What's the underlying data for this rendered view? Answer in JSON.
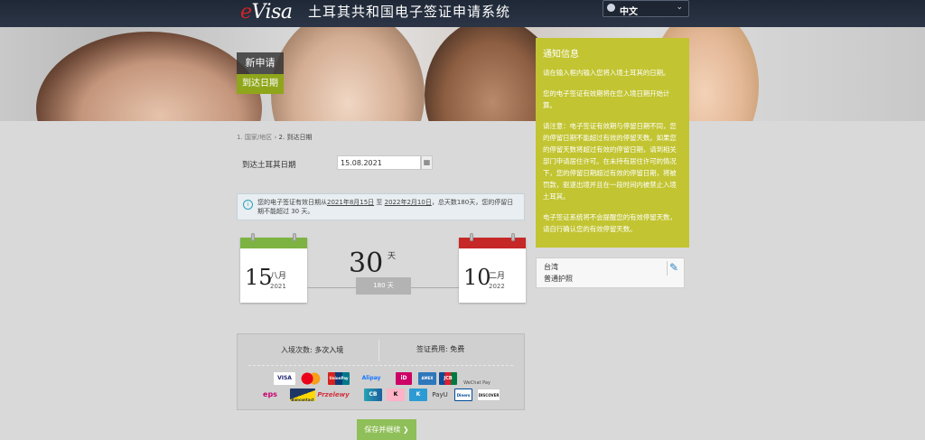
{
  "header": {
    "logo_e": "e",
    "logo_rest": "Visa",
    "title": "土耳其共和国电子签证申请系统",
    "language": "中文"
  },
  "hero": {
    "new_application": "新申请",
    "step_label": "到达日期"
  },
  "notice": {
    "title": "通知信息",
    "paragraphs": [
      "请在输入框内输入您将入境土耳其的日期。",
      "您的电子签证有效期将在您入境日期开始计算。",
      "请注意：电子签证有效期与停留日期不同，您的停留日期不能超过有效的停留天数。如果您的停留天数将超过有效的停留日期，请到相关部门申请居住许可。在未持有居住许可的情况下，您的停留日期超过有效的停留日期，将被罚款，驱逐出境并且在一段时间内被禁止入境土耳其。",
      "电子签证系统将不会提醒您的有效停留天数，请自行确认您的有效停留天数。"
    ]
  },
  "applicant": {
    "country": "台湾",
    "passport": "普通护照"
  },
  "breadcrumb": {
    "step1": "1. 国家/地区",
    "sep": "›",
    "step2": "2. 到达日期"
  },
  "form": {
    "arrival_label": "到达土耳其日期",
    "arrival_value": "15.08.2021"
  },
  "validity": {
    "prefix": "您的电子签证有效日期从",
    "start": "2021年8月15日",
    "mid": " 至 ",
    "end": "2022年2月10日",
    "suffix": "，总天数180天，您的停留日期不能超过 30 天。"
  },
  "calendar_start": {
    "day": "15",
    "month": "八月",
    "year": "2021"
  },
  "calendar_end": {
    "day": "10",
    "month": "二月",
    "year": "2022"
  },
  "stay": {
    "days": "30",
    "unit": "天",
    "total": "180 天"
  },
  "fees": {
    "entries_label": "入境次数:",
    "entries_value": "多次入境",
    "fee_label": "签证费用:",
    "fee_value": "免费"
  },
  "payment_methods": {
    "visa": "VISA",
    "mastercard": "MC",
    "unionpay": "UnionPay",
    "alipay": "Alipay",
    "ideal": "iD",
    "amex": "AMEX",
    "jcb": "JCB",
    "wechat": "WeChat Pay",
    "eps": "eps",
    "bancontact": "Bancontact",
    "przelewy": "Przelewy",
    "cb": "CB",
    "klarna": "K",
    "kbc": "K",
    "payu": "PayU",
    "diners": "Diners",
    "discover": "DISCOVER"
  },
  "actions": {
    "save_continue": "保存并继续"
  },
  "colors": {
    "accent_green": "#8fa61b",
    "notice_bg": "#c2c431",
    "cal_start": "#7cb342",
    "cal_end": "#c62828"
  }
}
